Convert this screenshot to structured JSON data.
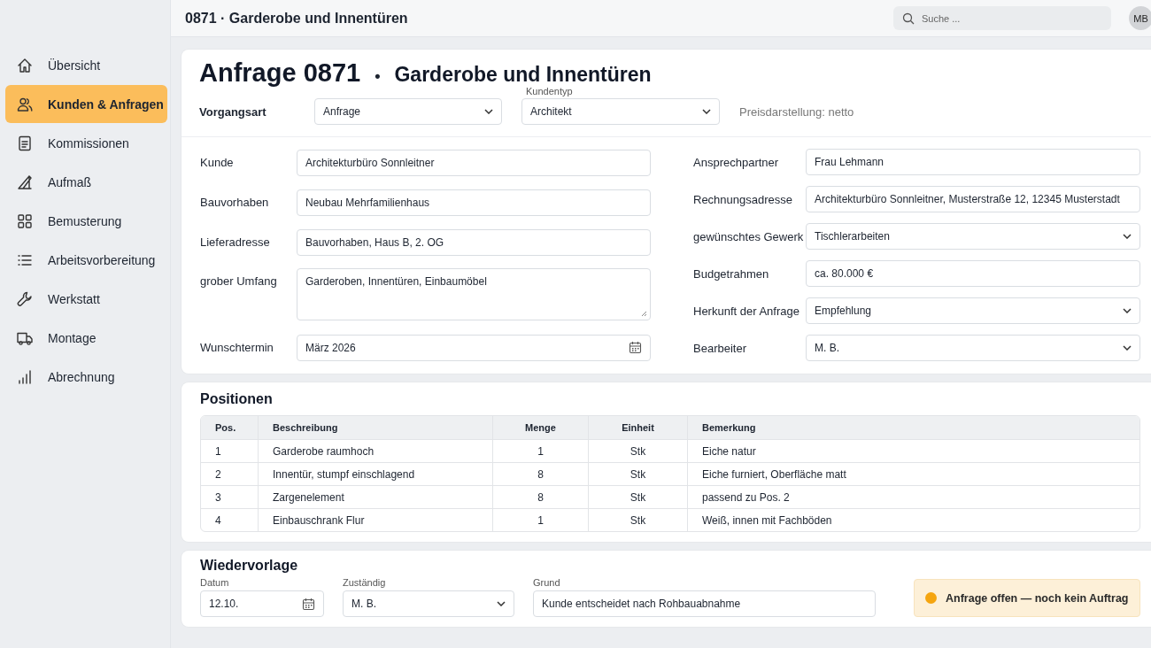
{
  "topbar": {
    "title": "0871 · Garderobe und Innentüren",
    "search": {
      "placeholder": "Suche ..."
    },
    "avatar": "MB"
  },
  "sidebar": {
    "items": [
      {
        "label": "Übersicht",
        "selected": false
      },
      {
        "label": "Kunden & Anfragen",
        "selected": true
      },
      {
        "label": "Kommissionen",
        "selected": false
      },
      {
        "label": "Aufmaß",
        "selected": false
      },
      {
        "label": "Bemusterung",
        "selected": false
      },
      {
        "label": "Arbeitsvorbereitung",
        "selected": false
      },
      {
        "label": "Werkstatt",
        "selected": false
      },
      {
        "label": "Montage",
        "selected": false
      },
      {
        "label": "Abrechnung",
        "selected": false
      }
    ]
  },
  "request": {
    "title": "Anfrage 0871",
    "separator": "•",
    "subtitle": "Garderobe und Innentüren",
    "process_type": {
      "label": "Vorgangsart",
      "kind": "select",
      "value": "Anfrage"
    },
    "customer_type": {
      "label": "Kundentyp",
      "kind": "select",
      "value": "Architekt"
    },
    "price_note": "Preisdarstellung: netto",
    "fields_left": [
      {
        "label": "Kunde",
        "kind": "text",
        "value": "Architekturbüro Sonnleitner"
      },
      {
        "label": "Bauvorhaben",
        "kind": "text",
        "value": "Neubau Mehrfamilienhaus"
      },
      {
        "label": "Lieferadresse",
        "kind": "text",
        "value": "Bauvorhaben, Haus B, 2. OG"
      },
      {
        "label": "grober Umfang",
        "kind": "textarea",
        "value": "Garderoben, Innentüren, Einbaumöbel"
      },
      {
        "label": "Wunschtermin",
        "kind": "date",
        "value": "März 2026"
      }
    ],
    "fields_right": [
      {
        "label": "Ansprechpartner",
        "kind": "text",
        "value": "Frau Lehmann"
      },
      {
        "label": "Rechnungsadresse",
        "kind": "text",
        "value": "Architekturbüro Sonnleitner, Musterstraße 12, 12345 Musterstadt"
      },
      {
        "label": "gewünschtes Gewerk",
        "kind": "select",
        "value": "Tischlerarbeiten"
      },
      {
        "label": "Budgetrahmen",
        "kind": "text",
        "value": "ca. 80.000 €"
      },
      {
        "label": "Herkunft der Anfrage",
        "kind": "select",
        "value": "Empfehlung"
      },
      {
        "label": "Bearbeiter",
        "kind": "select",
        "value": "M. B."
      }
    ]
  },
  "positions": {
    "title": "Positionen",
    "columns": [
      "Pos.",
      "Beschreibung",
      "Menge",
      "Einheit",
      "Bemerkung"
    ],
    "rows": [
      [
        "1",
        "Garderobe raumhoch",
        "1",
        "Stk",
        "Eiche natur"
      ],
      [
        "2",
        "Innentür, stumpf einschlagend",
        "8",
        "Stk",
        "Eiche furniert, Oberfläche matt"
      ],
      [
        "3",
        "Zargenelement",
        "8",
        "Stk",
        "passend zu Pos. 2"
      ],
      [
        "4",
        "Einbauschrank Flur",
        "1",
        "Stk",
        "Weiß, innen mit Fachböden"
      ]
    ]
  },
  "follow_up": {
    "title": "Wiedervorlage",
    "fields": [
      {
        "label": "Datum",
        "kind": "date",
        "value": "12.10."
      },
      {
        "label": "Zuständig",
        "kind": "select",
        "value": "M. B."
      },
      {
        "label": "Grund",
        "kind": "text",
        "value": "Kunde entscheidet nach Rohbauabnahme"
      }
    ],
    "status": "Anfrage offen — noch kein Auftrag"
  }
}
